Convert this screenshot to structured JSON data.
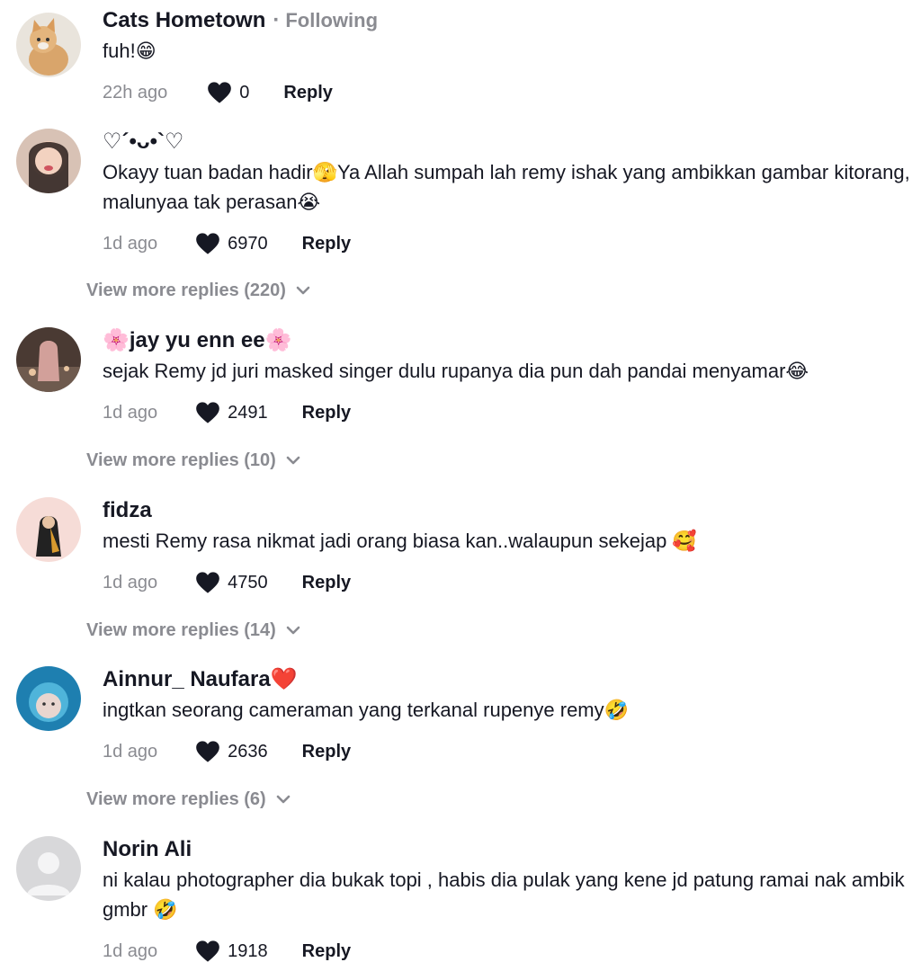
{
  "comments": [
    {
      "username": "Cats Hometown",
      "follow_label": "Following",
      "text": "fuh!😁",
      "time": "22h ago",
      "likes": "0",
      "reply_label": "Reply",
      "avatar_icon": "cat-avatar-icon"
    },
    {
      "username": "♡´•ᴗ•`♡",
      "text": "Okayy tuan badan hadir🫣Ya Allah sumpah lah remy ishak yang ambikkan gambar kitorang, malunyaa tak perasan😭",
      "time": "1d ago",
      "likes": "6970",
      "reply_label": "Reply",
      "more_replies": "View more replies (220)"
    },
    {
      "username": "🌸jay yu enn ee🌸",
      "text": "sejak Remy jd juri masked singer dulu rupanya dia pun dah pandai menyamar😂",
      "time": "1d ago",
      "likes": "2491",
      "reply_label": "Reply",
      "more_replies": "View more replies (10)"
    },
    {
      "username": "fidza",
      "text": "mesti Remy rasa nikmat jadi orang biasa kan..walaupun sekejap 🥰",
      "time": "1d ago",
      "likes": "4750",
      "reply_label": "Reply",
      "more_replies": "View more replies (14)"
    },
    {
      "username": "Ainnur_ Naufara❤️",
      "text": "ingtkan seorang cameraman yang terkanal rupenye remy🤣",
      "time": "1d ago",
      "likes": "2636",
      "reply_label": "Reply",
      "more_replies": "View more replies (6)"
    },
    {
      "username": "Norin Ali",
      "text": "ni kalau photographer dia bukak topi , habis dia pulak yang kene jd patung ramai nak ambik gmbr 🤣",
      "time": "1d ago",
      "likes": "1918",
      "reply_label": "Reply"
    }
  ],
  "colors": {
    "text": "#161823",
    "muted": "#8a8b91"
  }
}
